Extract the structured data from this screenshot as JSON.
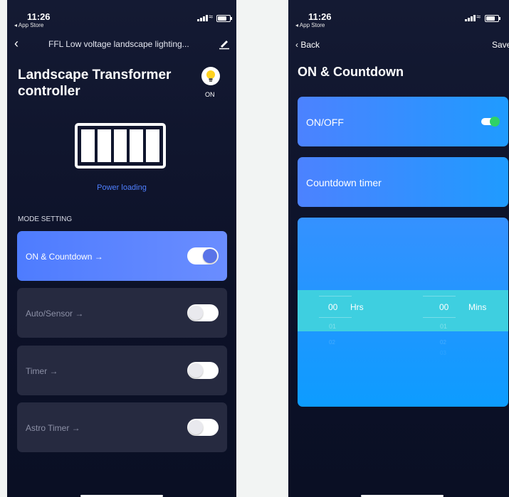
{
  "left_phone": {
    "status": {
      "time": "11:26",
      "back_app": "◂ App Store"
    },
    "nav": {
      "title": "FFL Low voltage landscape lighting...",
      "back_icon": "chevron-left-icon",
      "edit_icon": "pencil-icon"
    },
    "header": {
      "title_line1": "Landscape Transformer",
      "title_line2": "controller",
      "bulb_icon": "lightbulb-icon",
      "bulb_state": "ON"
    },
    "power_label": "Power loading",
    "mode_section_label": "MODE SETTING",
    "modes": [
      {
        "label": "ON & Countdown  →",
        "on": true
      },
      {
        "label": "Auto/Sensor  →",
        "on": false
      },
      {
        "label": "Timer  →",
        "on": false
      },
      {
        "label": "Astro Timer  →",
        "on": false
      }
    ]
  },
  "right_phone": {
    "status": {
      "time": "11:26",
      "back_app": "◂ App Store"
    },
    "nav": {
      "back": "Back",
      "save": "Save"
    },
    "title": "ON & Countdown",
    "onoff_label": "ON/OFF",
    "countdown_label": "Countdown timer",
    "picker": {
      "hours": "00",
      "hours_unit": "Hrs",
      "mins": "00",
      "mins_unit": "Mins",
      "next1": "01",
      "next2": "02",
      "next3": "03"
    }
  },
  "colors": {
    "accent": "#4e7cff",
    "toggle_on": "#2fd267",
    "highlight": "#3ecfe0"
  }
}
